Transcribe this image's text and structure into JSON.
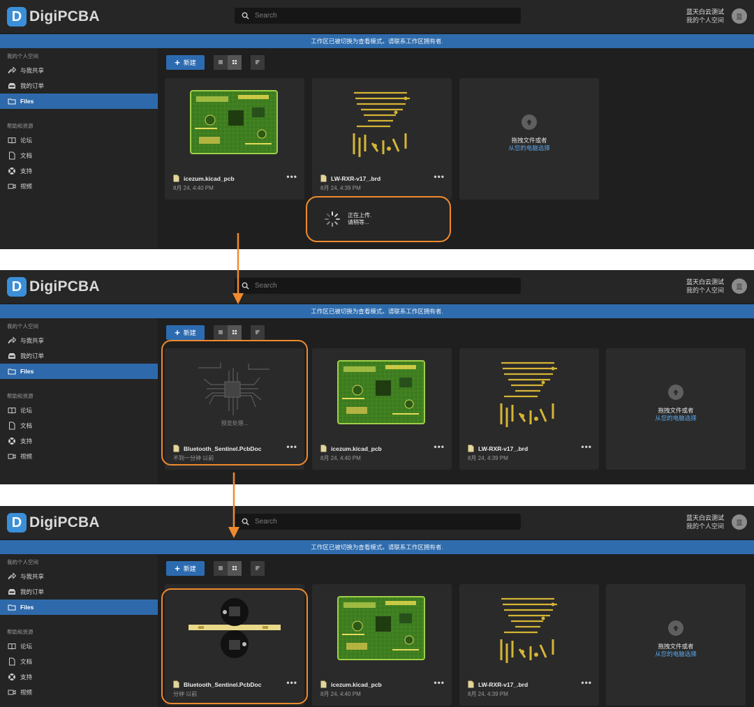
{
  "colors": {
    "accent": "#2e6aab",
    "highlight": "#ef8a2f",
    "banner": "#2f6cad",
    "link": "#5aa7ea"
  },
  "header": {
    "logo_letter": "D",
    "logo_strong": "Digi",
    "logo_rest": "PCBA",
    "search_placeholder": "Search",
    "user_name": "蓝天白云测试",
    "user_space": "我的个人空间",
    "avatar_text": "蓝"
  },
  "banner_text": "工作区已被切换为查看模式。请联系工作区拥有者.",
  "sidebar": {
    "section_personal": "我的个人空间",
    "items": [
      {
        "label": "与我共享",
        "icon": "share-icon"
      },
      {
        "label": "我的订单",
        "icon": "inbox-icon"
      },
      {
        "label": "Files",
        "icon": "folder-icon"
      }
    ],
    "section_help": "帮助和资源",
    "help_items": [
      {
        "label": "论坛",
        "icon": "book-icon"
      },
      {
        "label": "文档",
        "icon": "document-icon"
      },
      {
        "label": "支持",
        "icon": "lifebuoy-icon"
      },
      {
        "label": "视频",
        "icon": "video-icon"
      }
    ]
  },
  "toolbar": {
    "new_label": "新建"
  },
  "upload": {
    "text": "拖拽文件或者",
    "link": "从您的电脑选择"
  },
  "files": {
    "icezum": {
      "name": "icezum.kicad_pcb",
      "date": "8月 24, 4:40 PM"
    },
    "lw": {
      "name": "LW-RXR-v17_.brd",
      "date": "8月 24, 4:39 PM"
    },
    "bluetooth_processing": {
      "name": "Bluetooth_Sentinel.PcbDoc",
      "date": "不到一分钟 以前",
      "status": "预览处理..."
    },
    "bluetooth_done": {
      "name": "Bluetooth_Sentinel.PcbDoc",
      "date": "分钟 以前"
    }
  },
  "toast": {
    "line1": "正在上传.",
    "line2": "请稍等..."
  },
  "more_label": "•••"
}
